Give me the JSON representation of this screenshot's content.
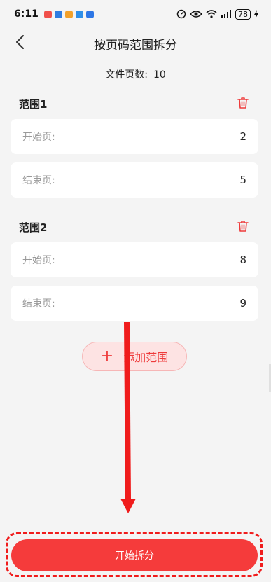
{
  "status_bar": {
    "time": "6:11",
    "battery": "78"
  },
  "header": {
    "title": "按页码范围拆分"
  },
  "file_info": {
    "label": "文件页数:",
    "value": "10"
  },
  "ranges": [
    {
      "label": "范围1",
      "start_label": "开始页:",
      "start_value": "2",
      "end_label": "结束页:",
      "end_value": "5"
    },
    {
      "label": "范围2",
      "start_label": "开始页:",
      "start_value": "8",
      "end_label": "结束页:",
      "end_value": "9"
    }
  ],
  "add_range": {
    "label": "添加范围"
  },
  "start_split": {
    "label": "开始拆分"
  },
  "colors": {
    "accent": "#f53b3b",
    "annotation": "#f01c1c",
    "background": "#f4f4f4"
  },
  "icons": [
    "back-icon",
    "delete-icon",
    "plus-icon",
    "wifi-icon",
    "signal-icon",
    "eye-icon"
  ]
}
